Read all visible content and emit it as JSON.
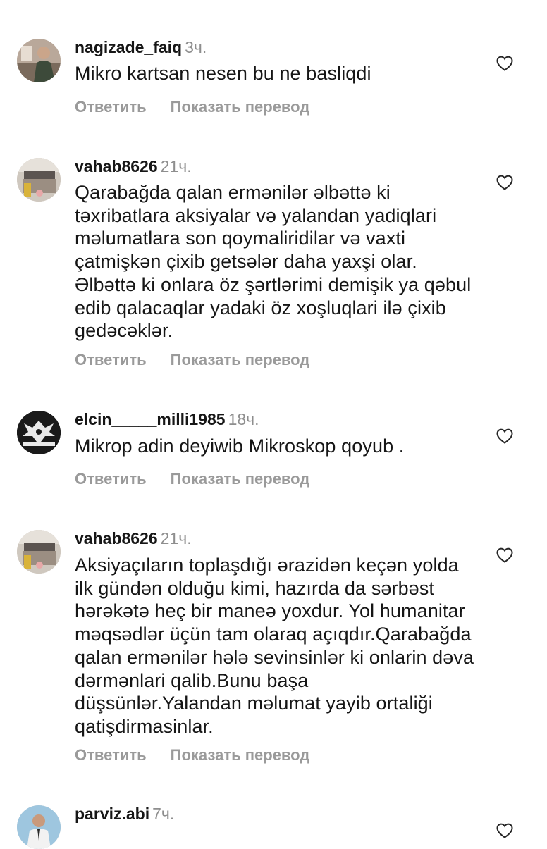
{
  "actions": {
    "reply": "Ответить",
    "translate": "Показать перевод"
  },
  "comments": [
    {
      "username": "nagizade_faiq",
      "time": "3ч.",
      "text": "Mikro kartsan nesen bu ne basliqdi",
      "avatar_icon": "person-photo-avatar",
      "like_icon": "heart-outline-icon"
    },
    {
      "username": "vahab8626",
      "time": "21ч.",
      "text": "Qarabağda qalan ermənilər əlbəttə ki təxribatlara aksiyalar və yalandan yadiqlari məlumatlara son qoymaliridilar və vaxti çatmişkən çixib getsələr daha yaxşi olar. Əlbəttə ki onlara öz şərtlərimi demişik ya qəbul edib qalacaqlar yadaki öz xoşluqlari ilə çixib gedəcəklər.",
      "avatar_icon": "room-photo-avatar",
      "like_icon": "heart-outline-icon"
    },
    {
      "username": "elcin_____milli1985",
      "time": "18ч.",
      "text": "Mikrop adin deyiwib Mikroskop qoyub .",
      "avatar_icon": "emblem-avatar",
      "like_icon": "heart-outline-icon"
    },
    {
      "username": "vahab8626",
      "time": "21ч.",
      "text": "Aksiyaçıların toplaşdığı ərazidən keçən yolda ilk gündən olduğu kimi, hazırda da sərbəst hərəkətə heç bir maneə yoxdur. Yol humanitar məqsədlər üçün tam olaraq açıqdır.Qarabağda qalan ermənilər hələ sevinsinlər ki onlarin dəva dərmənlari qalib.Bunu başa düşsünlər.Yalandan məlumat yayib ortaliği qatişdirmasinlar.",
      "avatar_icon": "room-photo-avatar",
      "like_icon": "heart-outline-icon"
    },
    {
      "username": "parviz.abi",
      "time": "7ч.",
      "text": "",
      "avatar_icon": "person-photo-avatar",
      "like_icon": "heart-outline-icon"
    }
  ],
  "colors": {
    "username": "#161616",
    "meta": "#8e8e8e",
    "actions": "#9a9a9a",
    "text": "#161616"
  }
}
